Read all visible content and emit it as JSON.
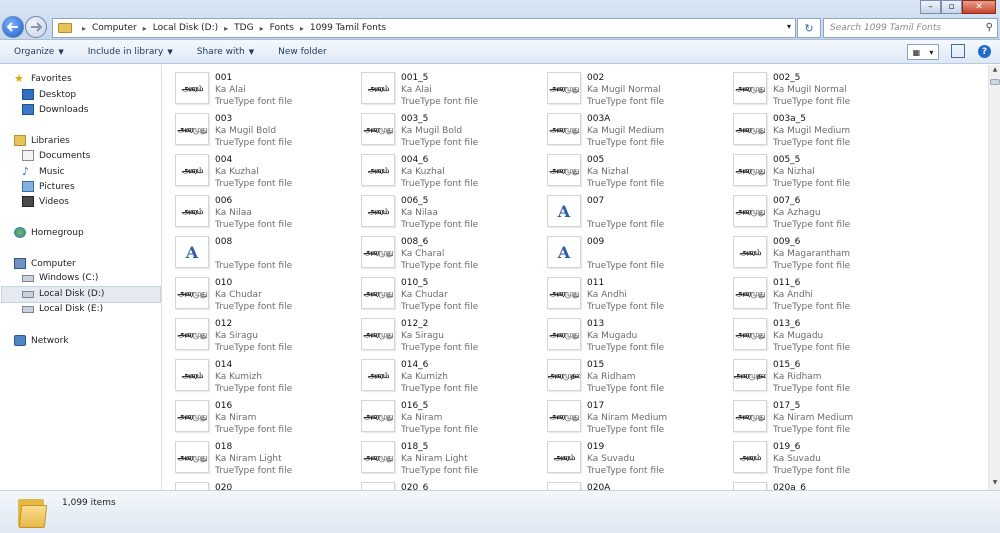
{
  "address": {
    "crumbs": [
      "Computer",
      "Local Disk (D:)",
      "TDG",
      "Fonts",
      "1099 Tamil Fonts"
    ],
    "search_placeholder": "Search 1099 Tamil Fonts"
  },
  "toolbar": {
    "organize": "Organize",
    "include_in_library": "Include in library",
    "share_with": "Share with",
    "new_folder": "New folder"
  },
  "nav": {
    "favorites": "Favorites",
    "desktop": "Desktop",
    "downloads": "Downloads",
    "libraries": "Libraries",
    "documents": "Documents",
    "music": "Music",
    "pictures": "Pictures",
    "videos": "Videos",
    "homegroup": "Homegroup",
    "computer": "Computer",
    "windows_c": "Windows (C:)",
    "local_disk_d": "Local Disk (D:)",
    "local_disk_e": "Local Disk (E:)",
    "network": "Network"
  },
  "files": [
    {
      "name": "001",
      "font": "Ka Alai",
      "type": "TrueType font file",
      "preview": "அகரம்"
    },
    {
      "name": "001_5",
      "font": "Ka Alai",
      "type": "TrueType font file",
      "preview": "அகரம்"
    },
    {
      "name": "002",
      "font": "Ka Mugil Normal",
      "type": "TrueType font file",
      "preview": "அகரமுது"
    },
    {
      "name": "002_5",
      "font": "Ka Mugil Normal",
      "type": "TrueType font file",
      "preview": "அகரமுது"
    },
    {
      "name": "003",
      "font": "Ka Mugil Bold",
      "type": "TrueType font file",
      "preview": "அகரமுது"
    },
    {
      "name": "003_5",
      "font": "Ka Mugil Bold",
      "type": "TrueType font file",
      "preview": "அகரமுது"
    },
    {
      "name": "003A",
      "font": "Ka Mugil Medium",
      "type": "TrueType font file",
      "preview": "அகரமுது"
    },
    {
      "name": "003a_5",
      "font": "Ka Mugil Medium",
      "type": "TrueType font file",
      "preview": "அகரமுது"
    },
    {
      "name": "004",
      "font": "Ka Kuzhal",
      "type": "TrueType font file",
      "preview": "அகரம்"
    },
    {
      "name": "004_6",
      "font": "Ka Kuzhal",
      "type": "TrueType font file",
      "preview": "அகரம்"
    },
    {
      "name": "005",
      "font": "Ka Nizhal",
      "type": "TrueType font file",
      "preview": "அகரமுது"
    },
    {
      "name": "005_5",
      "font": "Ka Nizhal",
      "type": "TrueType font file",
      "preview": "அகரமுது"
    },
    {
      "name": "006",
      "font": "Ka Nilaa",
      "type": "TrueType font file",
      "preview": "அகரம்"
    },
    {
      "name": "006_5",
      "font": "Ka Nilaa",
      "type": "TrueType font file",
      "preview": "அகரம்"
    },
    {
      "name": "007",
      "font": "",
      "type": "TrueType font file",
      "preview": "A"
    },
    {
      "name": "007_6",
      "font": "Ka Azhagu",
      "type": "TrueType font file",
      "preview": "அகரமுது"
    },
    {
      "name": "008",
      "font": "",
      "type": "TrueType font file",
      "preview": "A"
    },
    {
      "name": "008_6",
      "font": "Ka Charal",
      "type": "TrueType font file",
      "preview": "அகரமுது"
    },
    {
      "name": "009",
      "font": "",
      "type": "TrueType font file",
      "preview": "A"
    },
    {
      "name": "009_6",
      "font": "Ka Magarantham",
      "type": "TrueType font file",
      "preview": "அகரம்"
    },
    {
      "name": "010",
      "font": "Ka Chudar",
      "type": "TrueType font file",
      "preview": "அகரமுது"
    },
    {
      "name": "010_5",
      "font": "Ka Chudar",
      "type": "TrueType font file",
      "preview": "அகரமுது"
    },
    {
      "name": "011",
      "font": "Ka Andhi",
      "type": "TrueType font file",
      "preview": "அகரமுது"
    },
    {
      "name": "011_6",
      "font": "Ka Andhi",
      "type": "TrueType font file",
      "preview": "அகரமுது"
    },
    {
      "name": "012",
      "font": "Ka Siragu",
      "type": "TrueType font file",
      "preview": "அகரமுது"
    },
    {
      "name": "012_2",
      "font": "Ka Siragu",
      "type": "TrueType font file",
      "preview": "அகரமுது"
    },
    {
      "name": "013",
      "font": "Ka Mugadu",
      "type": "TrueType font file",
      "preview": "அகரமுது"
    },
    {
      "name": "013_6",
      "font": "Ka Mugadu",
      "type": "TrueType font file",
      "preview": "அகரமுது"
    },
    {
      "name": "014",
      "font": "Ka Kumizh",
      "type": "TrueType font file",
      "preview": "அகரம்"
    },
    {
      "name": "014_6",
      "font": "Ka Kumizh",
      "type": "TrueType font file",
      "preview": "அகரம்"
    },
    {
      "name": "015",
      "font": "Ka Ridham",
      "type": "TrueType font file",
      "preview": "அகரமுதல"
    },
    {
      "name": "015_6",
      "font": "Ka Ridham",
      "type": "TrueType font file",
      "preview": "அகரமுதல"
    },
    {
      "name": "016",
      "font": "Ka Niram",
      "type": "TrueType font file",
      "preview": "அகரமுது"
    },
    {
      "name": "016_5",
      "font": "Ka Niram",
      "type": "TrueType font file",
      "preview": "அகரமுது"
    },
    {
      "name": "017",
      "font": "Ka Niram Medium",
      "type": "TrueType font file",
      "preview": "அகரமுது"
    },
    {
      "name": "017_5",
      "font": "Ka Niram Medium",
      "type": "TrueType font file",
      "preview": "அகரமுது"
    },
    {
      "name": "018",
      "font": "Ka Niram Light",
      "type": "TrueType font file",
      "preview": "அகரமுது"
    },
    {
      "name": "018_5",
      "font": "Ka Niram Light",
      "type": "TrueType font file",
      "preview": "அகரமுது"
    },
    {
      "name": "019",
      "font": "Ka Suvadu",
      "type": "TrueType font file",
      "preview": "அகரம்"
    },
    {
      "name": "019_6",
      "font": "Ka Suvadu",
      "type": "TrueType font file",
      "preview": "அகரம்"
    },
    {
      "name": "020",
      "font": "",
      "type": "",
      "preview": ""
    },
    {
      "name": "020_6",
      "font": "",
      "type": "",
      "preview": ""
    },
    {
      "name": "020A",
      "font": "",
      "type": "",
      "preview": ""
    },
    {
      "name": "020a_6",
      "font": "",
      "type": "",
      "preview": ""
    }
  ],
  "status": {
    "item_count": "1,099 items"
  }
}
